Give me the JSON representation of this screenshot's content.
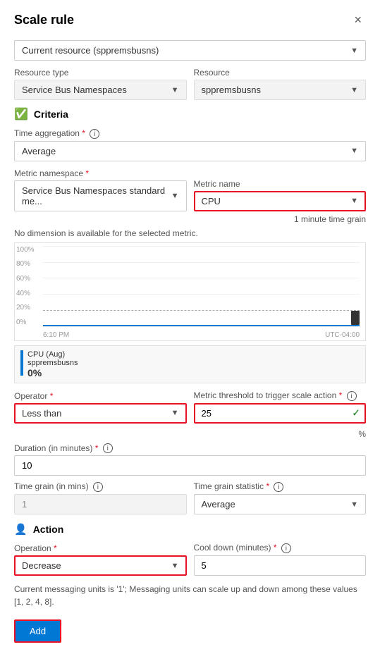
{
  "panel": {
    "title": "Scale rule",
    "close_label": "×"
  },
  "current_resource": {
    "label": "Current resource (sppremsbusns)",
    "value": "Current resource (sppremsbusns)"
  },
  "resource_type": {
    "label": "Resource type",
    "value": "Service Bus Namespaces"
  },
  "resource": {
    "label": "Resource",
    "value": "sppremsbusns"
  },
  "criteria": {
    "title": "Criteria"
  },
  "time_aggregation": {
    "label": "Time aggregation",
    "required": "*",
    "value": "Average"
  },
  "metric_namespace": {
    "label": "Metric namespace",
    "required": "*",
    "value": "Service Bus Namespaces standard me..."
  },
  "metric_name": {
    "label": "Metric name",
    "value": "CPU",
    "time_grain": "1 minute time grain"
  },
  "no_dimension_msg": "No dimension is available for the selected metric.",
  "chart": {
    "y_labels": [
      "100%",
      "80%",
      "60%",
      "40%",
      "20%",
      "0%"
    ],
    "x_labels": [
      "6:10 PM",
      "UTC-04:00"
    ],
    "dashed_line_pct": 20
  },
  "legend": {
    "text": "CPU (Aug)\nsppremsbusns",
    "value": "0%"
  },
  "operator": {
    "label": "Operator",
    "required": "*",
    "value": "Less than"
  },
  "metric_threshold": {
    "label": "Metric threshold to trigger scale action",
    "required": "*",
    "value": "25",
    "unit": "%"
  },
  "duration": {
    "label": "Duration (in minutes)",
    "required": "*",
    "value": "10"
  },
  "time_grain_mins": {
    "label": "Time grain (in mins)",
    "value": "1"
  },
  "time_grain_statistic": {
    "label": "Time grain statistic",
    "required": "*",
    "value": "Average"
  },
  "action": {
    "title": "Action"
  },
  "operation": {
    "label": "Operation",
    "required": "*",
    "value": "Decrease"
  },
  "cool_down": {
    "label": "Cool down (minutes)",
    "required": "*",
    "value": "5"
  },
  "messaging_note": "Current messaging units is '1'; Messaging units can scale up and down among these values [1, 2, 4, 8].",
  "add_button": {
    "label": "Add"
  }
}
